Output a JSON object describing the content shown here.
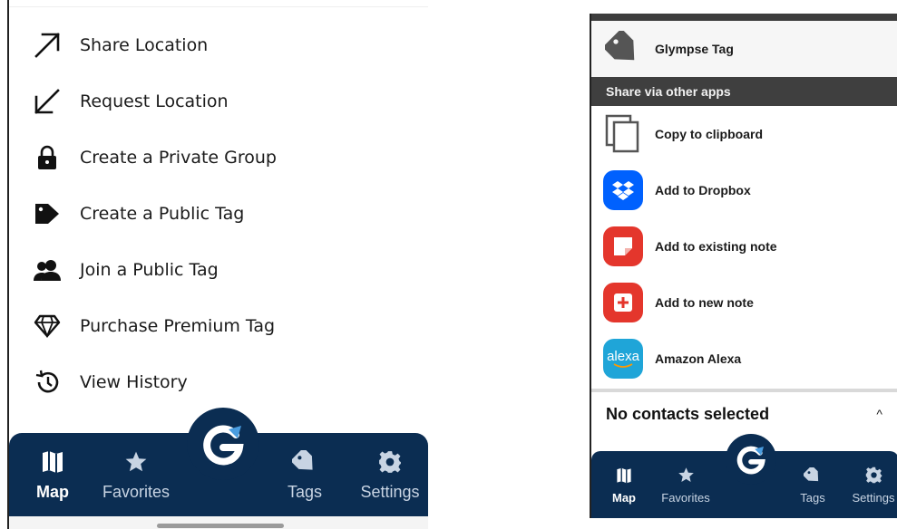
{
  "left": {
    "menu": [
      {
        "label": "Share Location",
        "icon": "arrow-up-right-icon"
      },
      {
        "label": "Request Location",
        "icon": "arrow-down-left-icon"
      },
      {
        "label": "Create a Private Group",
        "icon": "lock-icon"
      },
      {
        "label": "Create a Public Tag",
        "icon": "tag-icon"
      },
      {
        "label": "Join a Public Tag",
        "icon": "people-icon"
      },
      {
        "label": "Purchase Premium Tag",
        "icon": "diamond-icon"
      },
      {
        "label": "View History",
        "icon": "history-icon"
      }
    ],
    "nav": {
      "map": "Map",
      "favorites": "Favorites",
      "tags": "Tags",
      "settings": "Settings",
      "active": "Map"
    }
  },
  "right": {
    "glympse_tag": "Glympse Tag",
    "section_header": "Share via other apps",
    "share_options": [
      {
        "label": "Copy to clipboard",
        "icon": "copy-icon"
      },
      {
        "label": "Add to Dropbox",
        "icon": "dropbox-icon",
        "color": "#0061fe"
      },
      {
        "label": "Add to existing note",
        "icon": "note-icon",
        "color": "#e4362c"
      },
      {
        "label": "Add to new note",
        "icon": "new-note-icon",
        "color": "#e4362c"
      },
      {
        "label": "Amazon Alexa",
        "icon": "alexa-icon",
        "color": "#1fa5d8",
        "icon_text": "alexa"
      }
    ],
    "contacts_status": "No contacts selected",
    "nav": {
      "map": "Map",
      "favorites": "Favorites",
      "tags": "Tags",
      "settings": "Settings",
      "active": "Map"
    }
  },
  "colors": {
    "nav_bg": "#0b2d52",
    "section_bg": "#3f3f3f"
  }
}
